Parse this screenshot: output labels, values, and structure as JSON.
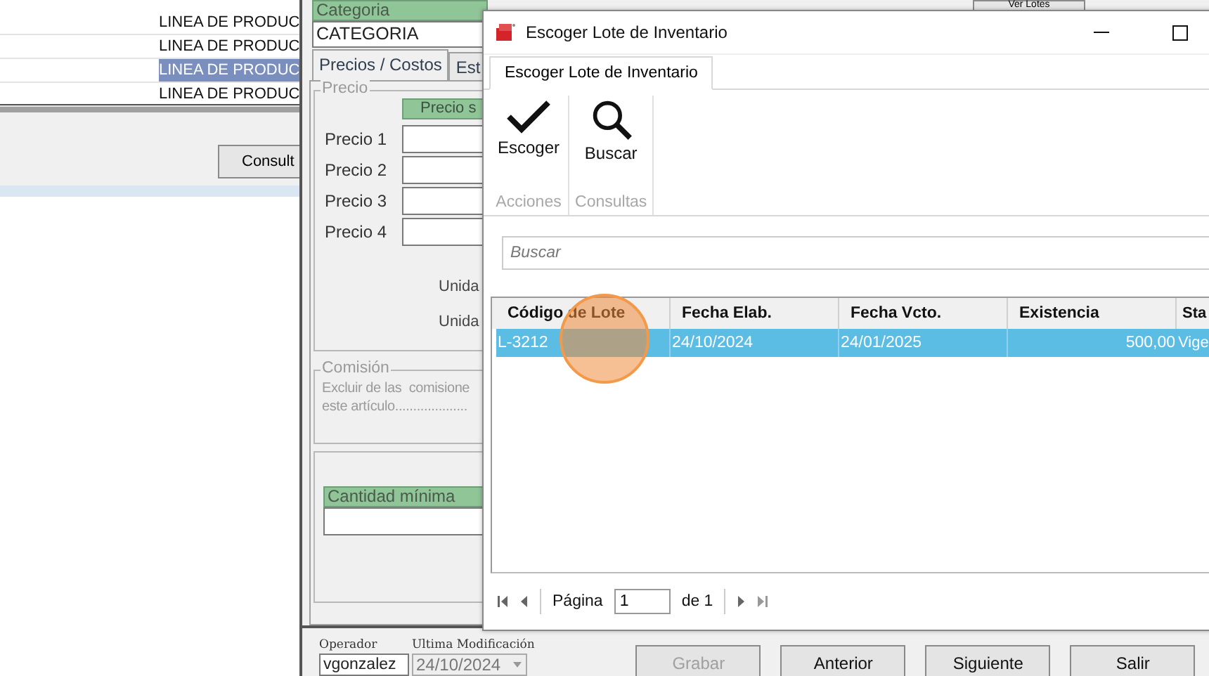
{
  "background_list": {
    "rows": [
      {
        "text": "LINEA DE PRODUC",
        "selected": false
      },
      {
        "text": "LINEA DE PRODUC",
        "selected": false
      },
      {
        "text": "LINEA DE PRODUC",
        "selected": true
      },
      {
        "text": "LINEA DE PRODUC",
        "selected": false
      }
    ],
    "button": "Consult"
  },
  "product_form": {
    "category_label": "Categoria",
    "category_value": "CATEGORIA",
    "ver_lotes": "Ver Lotes",
    "tabs": [
      {
        "label": "Precios / Costos",
        "selected": true
      },
      {
        "label": "Est",
        "selected": false
      }
    ],
    "price_group": "Precio",
    "price_header": "Precio s",
    "prices": [
      "Precio 1",
      "Precio 2",
      "Precio 3",
      "Precio 4"
    ],
    "unit_labels": [
      "Unida",
      "Unida"
    ],
    "commission_group": "Comisión",
    "commission_lines": [
      "Excluir de las  comisione",
      "este artículo...................."
    ],
    "min_qty_label": "Cantidad mínima",
    "operator_label": "Operador",
    "modified_label": "Ultima Modificación",
    "operator_value": "vgonzalez",
    "modified_value": "24/10/2024",
    "buttons": [
      {
        "label": "Grabar",
        "disabled": true
      },
      {
        "label": "Anterior",
        "disabled": false
      },
      {
        "label": "Siguiente",
        "disabled": false
      },
      {
        "label": "Salir",
        "disabled": false
      }
    ]
  },
  "dialog": {
    "title": "Escoger Lote de Inventario",
    "tab": "Escoger Lote de Inventario",
    "actions": [
      {
        "label": "Escoger",
        "kind": "check"
      },
      {
        "label": "Buscar",
        "kind": "search"
      }
    ],
    "groups": [
      "Acciones",
      "Consultas"
    ],
    "search": {
      "placeholder": "Buscar"
    },
    "columns": [
      "Código de Lote",
      "Fecha Elab.",
      "Fecha Vcto.",
      "Existencia",
      "Sta"
    ],
    "rows": [
      {
        "cells": [
          "L-3212",
          "24/10/2024",
          "24/01/2025",
          "500,00",
          "Vige"
        ],
        "selected": true
      }
    ],
    "pager": {
      "label": "Página",
      "value": "1",
      "total": "de 1"
    }
  }
}
